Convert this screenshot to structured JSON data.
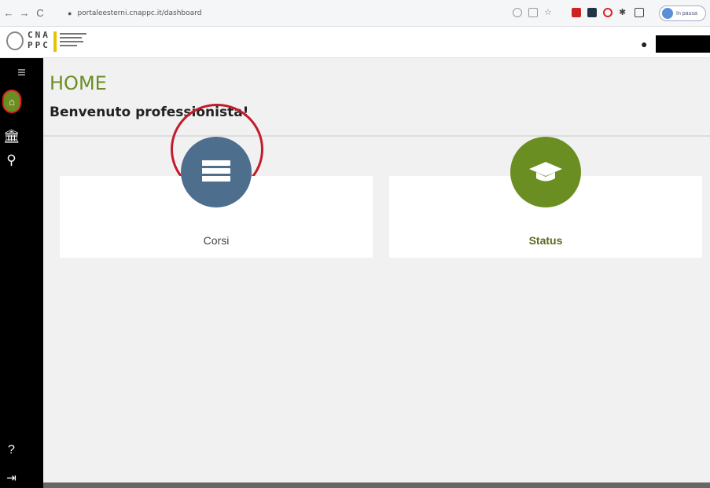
{
  "browser": {
    "back": "←",
    "forward": "→",
    "reload": "C",
    "url": "portaleesterni.cnappc.it/dashboard",
    "profile_label": "In pausa"
  },
  "header": {
    "logo_letters_top": "CNA",
    "logo_letters_bottom": "PPC"
  },
  "sidebar": {
    "menu_icon": "menu-icon",
    "items": [
      "home-icon",
      "bank-icon",
      "award-icon",
      "help-icon",
      "logout-icon"
    ]
  },
  "main": {
    "title": "HOME",
    "welcome": "Benvenuto professionista!",
    "cards": [
      {
        "label": "Corsi",
        "icon": "list-icon",
        "color": "#4e6e8e"
      },
      {
        "label": "Status",
        "icon": "graduation-cap-icon",
        "color": "#6b8e23"
      }
    ]
  },
  "colors": {
    "accent": "#6b8e23",
    "sidebar": "#000000",
    "highlight": "#c21c2c"
  }
}
